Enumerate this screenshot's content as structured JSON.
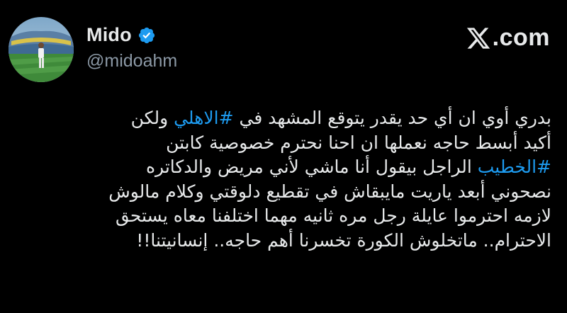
{
  "author": {
    "display_name": "Mido",
    "handle": "@midoahm",
    "verified": true,
    "verified_badge_icon": "verified-badge-icon",
    "avatar_icon": "avatar-photo"
  },
  "brand": {
    "logo_icon": "x-logo-icon",
    "text": ".com"
  },
  "tweet": {
    "lines": [
      {
        "before": "بدري أوي ان أي حد يقدر يتوقع المشهد في ",
        "hashtag": "#الاهلي",
        "after": " ولكن"
      },
      {
        "before": "أكيد أبسط حاجه نعملها ان احنا نحترم خصوصية كابتن",
        "hashtag": "",
        "after": ""
      },
      {
        "before": "",
        "hashtag": "#الخطيب",
        "after": " الراجل بيقول أنا ماشي لأني مريض والدكاتره"
      },
      {
        "before": "نصحوني أبعد ياريت مايبقاش في تقطيع دلوقتي وكلام مالوش",
        "hashtag": "",
        "after": ""
      },
      {
        "before": "لازمه احترموا عايلة رجل مره ثانيه مهما اختلفنا معاه يستحق",
        "hashtag": "",
        "after": ""
      },
      {
        "before": "الاحترام.. ماتخلوش الكورة تخسرنا أهم حاجه.. إنسانيتنا!!",
        "hashtag": "",
        "after": ""
      }
    ]
  },
  "colors": {
    "background": "#000000",
    "text": "#e7e9ea",
    "handle": "#8b98a5",
    "hashtag": "#1d9bf0",
    "verified": "#1d9bf0"
  }
}
